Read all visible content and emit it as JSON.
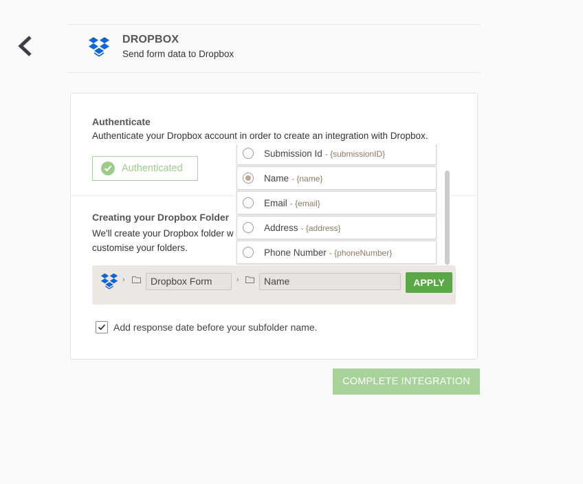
{
  "nav": {
    "back_icon": "chevron-left-icon"
  },
  "header": {
    "logo_icon": "dropbox-logo-icon",
    "title": "DROPBOX",
    "subtitle": "Send form data to Dropbox"
  },
  "auth": {
    "title": "Authenticate",
    "description": "Authenticate your Dropbox account in order to create an integration with Dropbox.",
    "button_label": "Authenticated",
    "button_icon": "check-circle-icon"
  },
  "folder": {
    "title": "Creating your Dropbox Folder",
    "description": "We'll create your Dropbox folder w customise your folders.",
    "path_root_value": "Dropbox Form",
    "path_sub_value": "Name",
    "apply_label": "APPLY",
    "date_checkbox_checked": true,
    "date_checkbox_label": "Add response date before your subfolder name."
  },
  "dropdown": {
    "selected": "Name",
    "options": [
      {
        "label": "Submission Id",
        "token": "- {submissionID}",
        "selected": false
      },
      {
        "label": "Name",
        "token": "- {name}",
        "selected": true
      },
      {
        "label": "Email",
        "token": "- {email}",
        "selected": false
      },
      {
        "label": "Address",
        "token": "- {address}",
        "selected": false
      },
      {
        "label": "Phone Number",
        "token": "- {phoneNumber}",
        "selected": false
      }
    ]
  },
  "footer": {
    "complete_label": "COMPLETE INTEGRATION"
  },
  "colors": {
    "dropbox_blue": "#0d64d8",
    "success_green": "#5aa845",
    "disabled_green": "#a7d39b"
  }
}
